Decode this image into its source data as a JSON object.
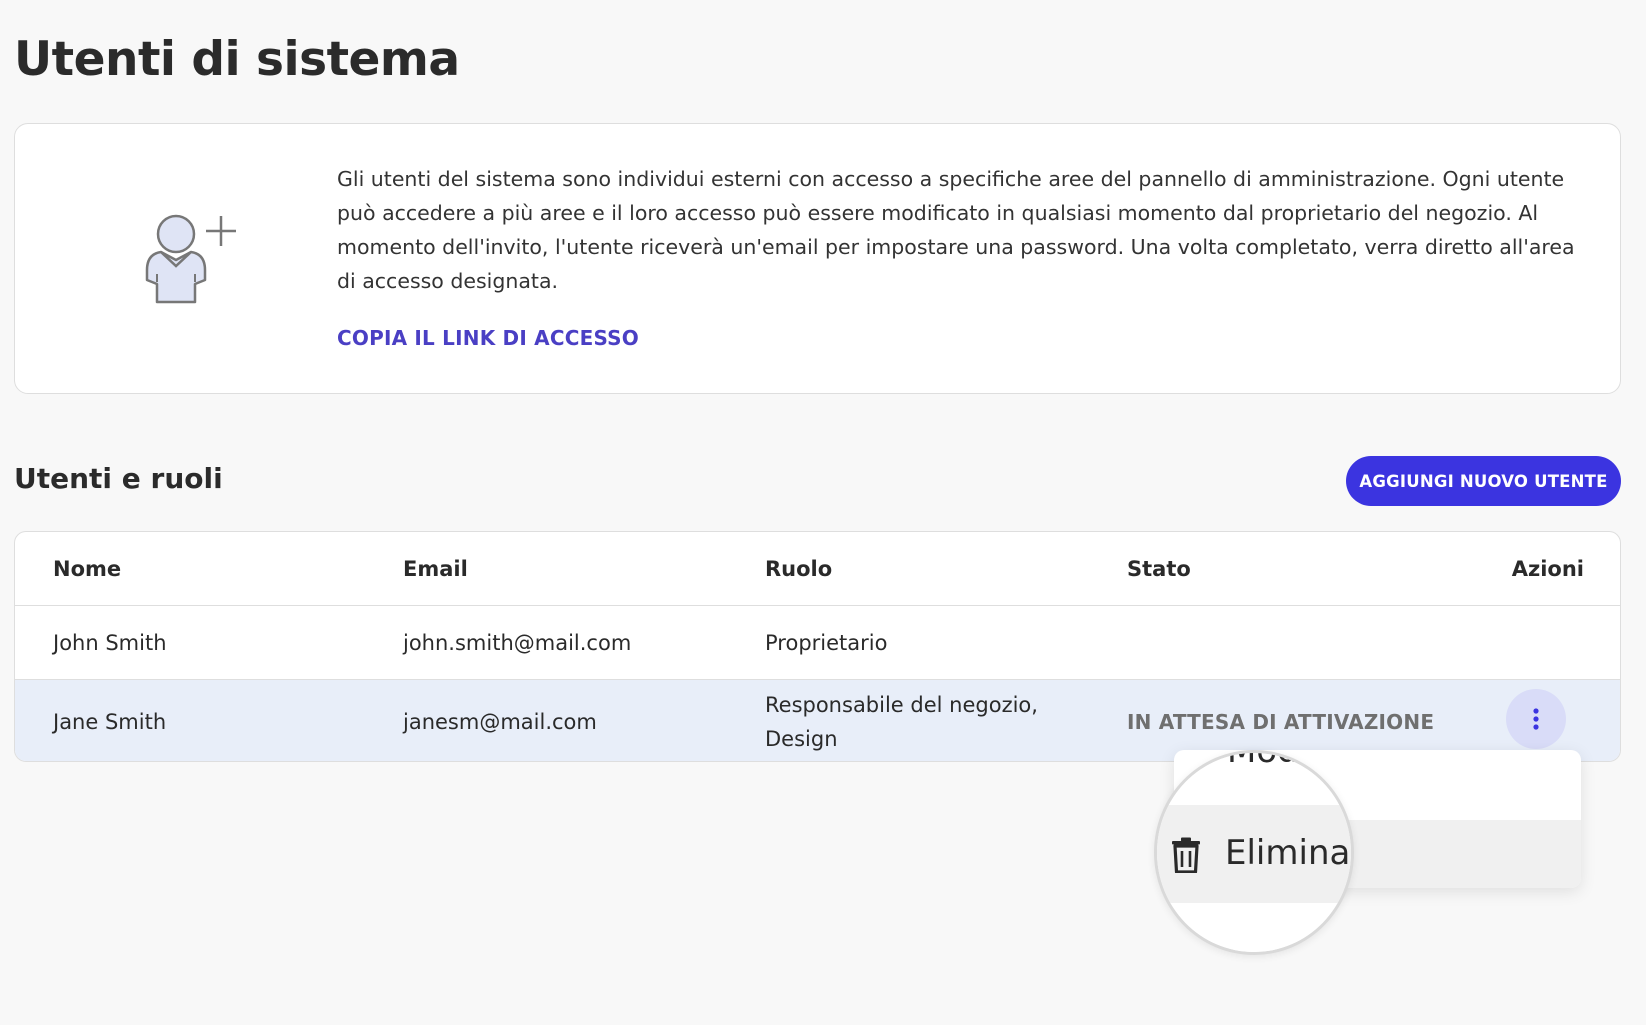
{
  "page": {
    "title": "Utenti di sistema"
  },
  "info": {
    "icon": "add-user-icon",
    "description": "Gli utenti del sistema sono individui esterni con accesso a specifiche aree del pannello di amministrazione. Ogni utente può accedere a più aree e il loro accesso può essere modificato in qualsiasi momento dal proprietario del negozio. Al momento dell'invito, l'utente riceverà un'email per impostare una password. Una volta completato, verra diretto all'area di accesso designata.",
    "copy_link_label": "COPIA IL LINK DI ACCESSO"
  },
  "users_section": {
    "title": "Utenti e ruoli",
    "add_button_label": "AGGIUNGI NUOVO UTENTE"
  },
  "table": {
    "columns": [
      "Nome",
      "Email",
      "Ruolo",
      "Stato",
      "Azioni"
    ],
    "rows": [
      {
        "name": "John Smith",
        "email": "john.smith@mail.com",
        "role": "Proprietario",
        "status": ""
      },
      {
        "name": "Jane Smith",
        "email": "janesm@mail.com",
        "role": "Responsabile del negozio, Design",
        "status": "IN ATTESA DI ATTIVAZIONE"
      }
    ]
  },
  "row_menu": {
    "kebab_icon": "more-vertical-icon",
    "edit_label_partial": "Mod.",
    "delete_label": "Elimina",
    "delete_icon": "trash-icon"
  },
  "colors": {
    "accent": "#3b34e0",
    "link": "#4a3fc4",
    "selected_row": "#e8eef9",
    "kebab_bg": "#d9dcf8"
  }
}
